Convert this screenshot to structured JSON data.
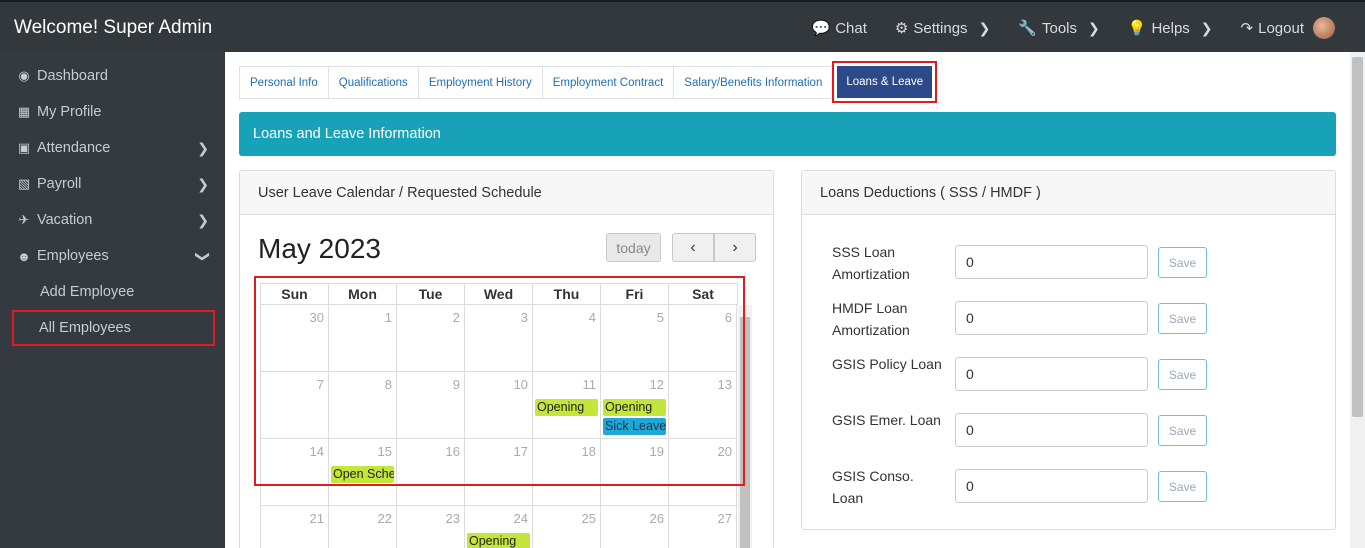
{
  "header": {
    "welcome": "Welcome! Super Admin",
    "nav": [
      {
        "label": "Chat",
        "icon": "chat-icon"
      },
      {
        "label": "Settings",
        "icon": "gear-icon"
      },
      {
        "label": "Tools",
        "icon": "wrench-icon"
      },
      {
        "label": "Helps",
        "icon": "lightbulb-icon"
      },
      {
        "label": "Logout",
        "icon": "logout-icon"
      }
    ]
  },
  "sidebar": {
    "items": [
      {
        "label": "Dashboard",
        "icon": "dashboard-icon"
      },
      {
        "label": "My Profile",
        "icon": "id-card-icon"
      },
      {
        "label": "Attendance",
        "icon": "calendar-icon"
      },
      {
        "label": "Payroll",
        "icon": "document-icon"
      },
      {
        "label": "Vacation",
        "icon": "plane-icon"
      },
      {
        "label": "Employees",
        "icon": "users-icon"
      }
    ],
    "sub_items": [
      "Add Employee",
      "All Employees"
    ]
  },
  "tabs": [
    "Personal Info",
    "Qualifications",
    "Employment History",
    "Employment Contract",
    "Salary/Benefits Information",
    "Loans & Leave"
  ],
  "banner": "Loans and Leave Information",
  "calendar": {
    "card_title": "User Leave Calendar / Requested Schedule",
    "month_title": "May 2023",
    "today_label": "today",
    "prev": "‹",
    "next": "›",
    "weekdays": [
      "Sun",
      "Mon",
      "Tue",
      "Wed",
      "Thu",
      "Fri",
      "Sat"
    ],
    "weeks": [
      [
        "30",
        "1",
        "2",
        "3",
        "4",
        "5",
        "6"
      ],
      [
        "7",
        "8",
        "9",
        "10",
        "11",
        "12",
        "13"
      ],
      [
        "14",
        "15",
        "16",
        "17",
        "18",
        "19",
        "20"
      ],
      [
        "21",
        "22",
        "23",
        "24",
        "25",
        "26",
        "27"
      ]
    ],
    "events": {
      "opening": "Opening",
      "sick": "Sick Leave",
      "open_sched": "Open Schedule"
    }
  },
  "loans": {
    "card_title": "Loans Deductions ( SSS / HMDF )",
    "save_label": "Save",
    "rows": [
      {
        "label": "SSS Loan Amortization",
        "value": "0"
      },
      {
        "label": "HMDF Loan Amortization",
        "value": "0"
      },
      {
        "label": "GSIS Policy Loan",
        "value": "0"
      },
      {
        "label": "GSIS Emer. Loan",
        "value": "0"
      },
      {
        "label": "GSIS Conso. Loan",
        "value": "0"
      }
    ]
  }
}
